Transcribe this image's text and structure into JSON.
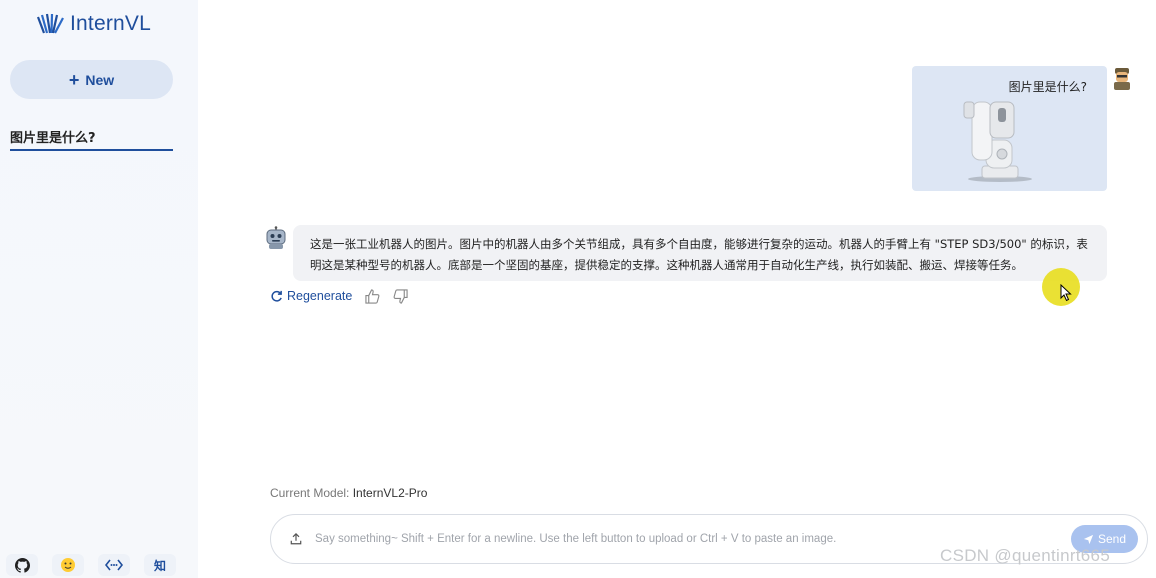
{
  "app": {
    "logo_text": "InternVL"
  },
  "sidebar": {
    "new_button_label": "New",
    "history": [
      {
        "title": "图片里是什么?"
      }
    ],
    "footer_icons": [
      "github-icon",
      "huggingface-icon",
      "api-icon",
      "zhihu-icon"
    ],
    "zhihu_label": "知"
  },
  "chat": {
    "user_message": {
      "text": "图片里是什么?",
      "has_image": true
    },
    "bot_message": {
      "text": "这是一张工业机器人的图片。图片中的机器人由多个关节组成，具有多个自由度，能够进行复杂的运动。机器人的手臂上有 \"STEP SD3/500\" 的标识，表明这是某种型号的机器人。底部是一个坚固的基座，提供稳定的支撑。这种机器人通常用于自动化生产线，执行如装配、搬运、焊接等任务。"
    },
    "actions": {
      "regenerate_label": "Regenerate"
    }
  },
  "footer": {
    "model_label": "Current Model:",
    "model_value": "InternVL2-Pro",
    "input_placeholder": "Say something~ Shift + Enter for a newline. Use the left button to upload or Ctrl + V to paste an image.",
    "send_label": "Send"
  },
  "watermark": "CSDN @quentinrt665",
  "colors": {
    "accent": "#1f4e9c",
    "user_bubble": "#dde6f4",
    "bot_bubble": "#f1f2f5",
    "send_button": "#a9c2ef"
  }
}
